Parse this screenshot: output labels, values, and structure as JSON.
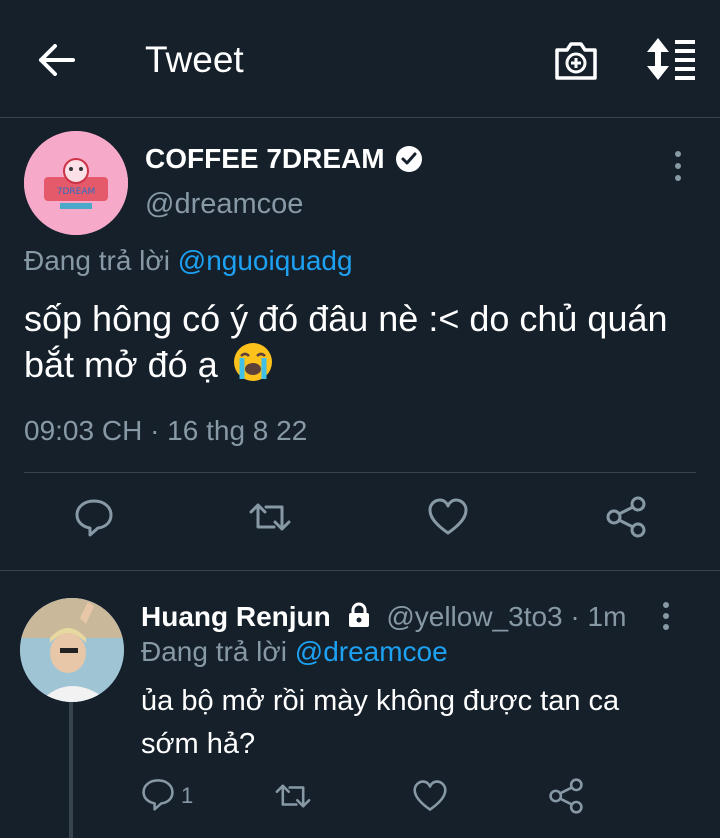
{
  "header": {
    "title": "Tweet",
    "back_icon": "arrow-left-icon",
    "camera_icon": "camera-plus-icon",
    "sort_icon": "sort-list-icon"
  },
  "tweet": {
    "author_name": "COFFEE 7DREAM",
    "handle": "@dreamcoe",
    "replying_prefix": "Đang trả lời",
    "replying_to": "@nguoiquadg",
    "text": "sốp hông có ý đó đâu nè :< do chủ quán bắt mở đó ạ",
    "emoji": "crying-face",
    "timestamp": "09:03 CH · 16 thg 8 22",
    "actions": [
      "reply-icon",
      "retweet-icon",
      "like-icon",
      "share-icon"
    ]
  },
  "reply": {
    "author_name": "Huang Renjun",
    "handle": "@yellow_3to3",
    "time": "· 1m",
    "replying_prefix": "Đang trả lời",
    "replying_to": "@dreamcoe",
    "text": "ủa bộ mở rồi mày không được tan ca sớm hả?",
    "reply_count": "1"
  },
  "colors": {
    "background": "#15202b",
    "muted": "#8899a6",
    "accent": "#1da1f2",
    "divider": "#38444d"
  }
}
